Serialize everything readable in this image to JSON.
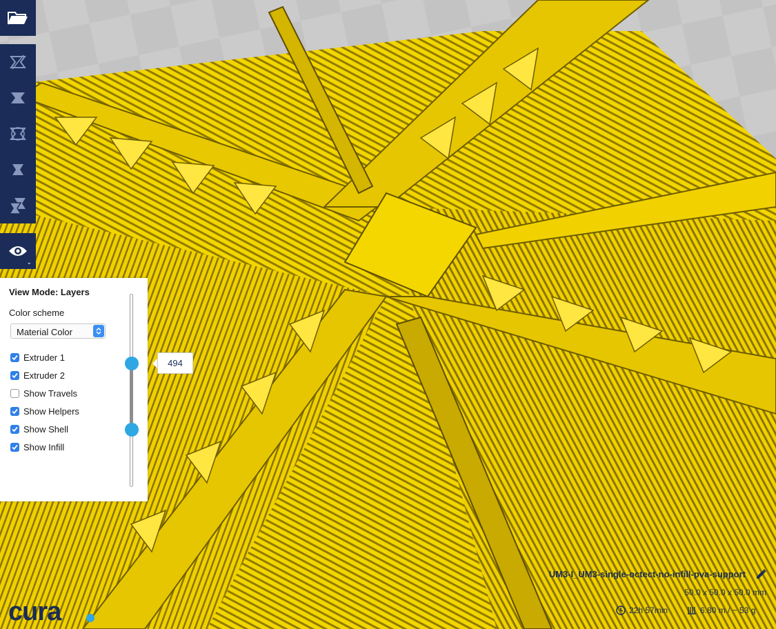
{
  "app": {
    "logo_text": "cura"
  },
  "toolbar": {
    "open_icon": "folder-open-icon",
    "tools": [
      "translate-icon",
      "scale-icon",
      "rotate-icon",
      "mirror-icon",
      "per-model-settings-icon"
    ],
    "view_icon": "eye-icon",
    "view_chevron": "⌄"
  },
  "view_panel": {
    "title": "View Mode: Layers",
    "color_scheme_label": "Color scheme",
    "color_scheme_value": "Material Color",
    "options": [
      {
        "label": "Extruder 1",
        "checked": true
      },
      {
        "label": "Extruder 2",
        "checked": true
      },
      {
        "label": "Show Travels",
        "checked": false
      },
      {
        "label": "Show Helpers",
        "checked": true
      },
      {
        "label": "Show Shell",
        "checked": true
      },
      {
        "label": "Show Infill",
        "checked": true
      }
    ],
    "layer_value": "494"
  },
  "job": {
    "name": "UM3-I_UM3-single-octect-no-infill-pva-support",
    "dimensions": "50.0 x 50.0 x 50.0 mm",
    "print_time": "22h 57min",
    "material": "6.80 m / ~ 53 g"
  },
  "colors": {
    "toolbar": "#1a2c57",
    "accent": "#2fa7e3",
    "model": "#f2d300",
    "checkbox": "#2f7fe8"
  }
}
